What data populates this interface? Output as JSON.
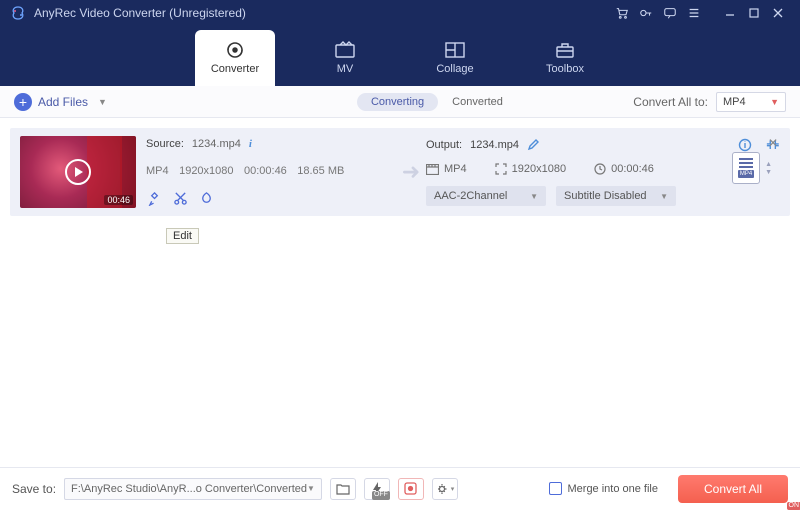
{
  "app": {
    "title": "AnyRec Video Converter (Unregistered)"
  },
  "tabs": {
    "converter": "Converter",
    "mv": "MV",
    "collage": "Collage",
    "toolbox": "Toolbox"
  },
  "toolbar": {
    "add_files": "Add Files",
    "converting": "Converting",
    "converted": "Converted",
    "convert_all_to": "Convert All to:",
    "format_value": "MP4"
  },
  "item": {
    "source_label": "Source:",
    "source_name": "1234.mp4",
    "src_format": "MP4",
    "src_res": "1920x1080",
    "src_dur": "00:00:46",
    "src_size": "18.65 MB",
    "thumb_dur": "00:46",
    "output_label": "Output:",
    "output_name": "1234.mp4",
    "out_format": "MP4",
    "out_res": "1920x1080",
    "out_dur": "00:00:46",
    "audio_dd": "AAC-2Channel",
    "sub_dd": "Subtitle Disabled",
    "swap_tag": "MP4"
  },
  "tooltip": {
    "edit": "Edit"
  },
  "footer": {
    "save_to": "Save to:",
    "path": "F:\\AnyRec Studio\\AnyR...o Converter\\Converted",
    "gpu_off": "OFF",
    "rec_on": "ON",
    "merge": "Merge into one file",
    "convert_all": "Convert All"
  }
}
